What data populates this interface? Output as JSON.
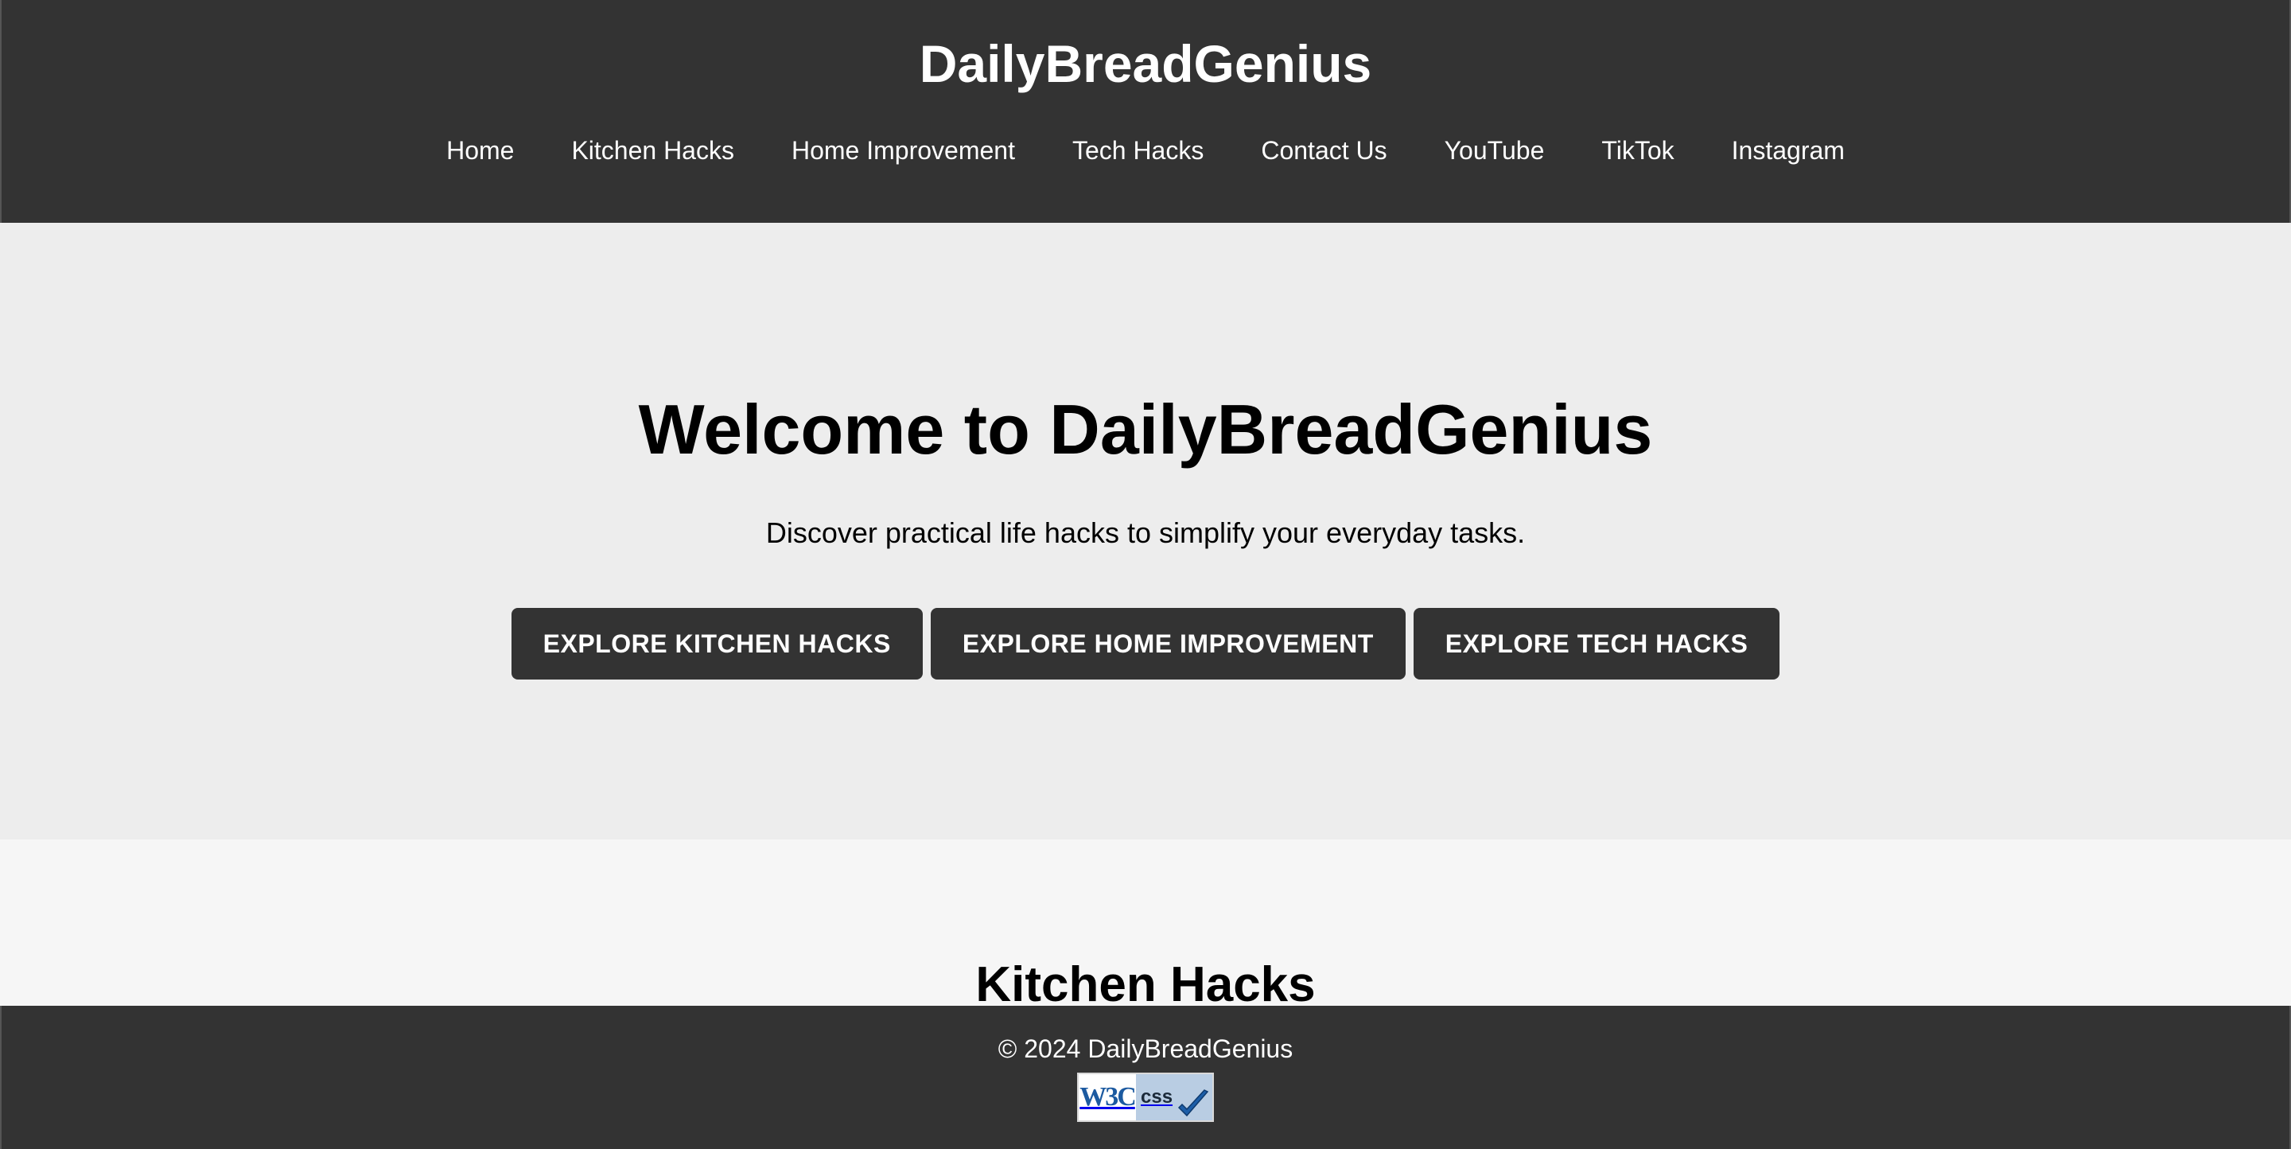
{
  "header": {
    "title": "DailyBreadGenius",
    "nav": [
      {
        "label": "Home"
      },
      {
        "label": "Kitchen Hacks"
      },
      {
        "label": "Home Improvement"
      },
      {
        "label": "Tech Hacks"
      },
      {
        "label": "Contact Us"
      },
      {
        "label": "YouTube"
      },
      {
        "label": "TikTok"
      },
      {
        "label": "Instagram"
      }
    ]
  },
  "hero": {
    "title": "Welcome to DailyBreadGenius",
    "subtitle": "Discover practical life hacks to simplify your everyday tasks.",
    "buttons": [
      {
        "label": "EXPLORE KITCHEN HACKS"
      },
      {
        "label": "EXPLORE HOME IMPROVEMENT"
      },
      {
        "label": "EXPLORE TECH HACKS"
      }
    ]
  },
  "sections": {
    "kitchen": {
      "title": "Kitchen Hacks"
    }
  },
  "footer": {
    "copyright": "© 2024 DailyBreadGenius",
    "badge": {
      "left_text": "W3C",
      "right_text": "css",
      "icon": "checkmark-icon"
    }
  },
  "colors": {
    "header_bg": "#333333",
    "hero_bg": "#ededed",
    "section_bg": "#f6f6f6",
    "button_bg": "#333333",
    "text_light": "#ffffff",
    "text_dark": "#000000"
  }
}
